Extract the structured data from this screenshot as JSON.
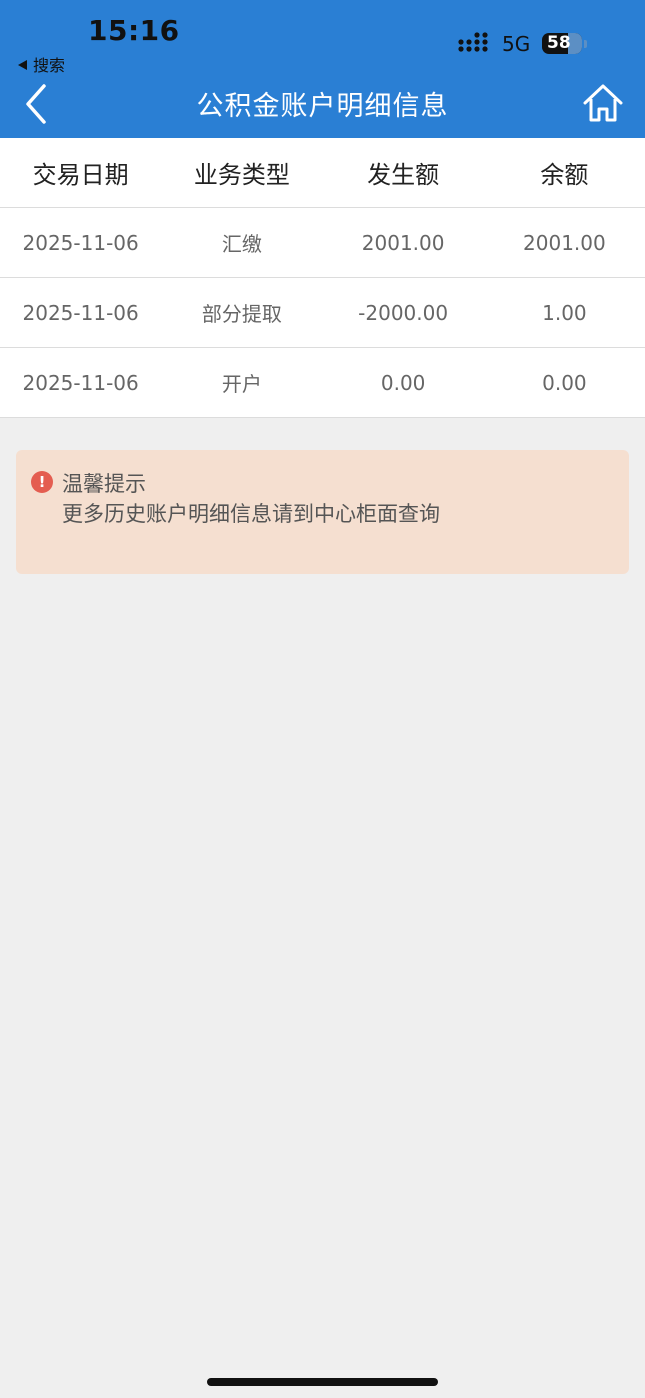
{
  "status_bar": {
    "time": "15:16",
    "back_label": "搜索",
    "network": "5G",
    "battery": "58"
  },
  "nav": {
    "title": "公积金账户明细信息",
    "back_icon": "chevron-left-icon",
    "home_icon": "home-icon"
  },
  "table": {
    "headers": [
      "交易日期",
      "业务类型",
      "发生额",
      "余额"
    ],
    "rows": [
      [
        "2025-11-06",
        "汇缴",
        "2001.00",
        "2001.00"
      ],
      [
        "2025-11-06",
        "部分提取",
        "-2000.00",
        "1.00"
      ],
      [
        "2025-11-06",
        "开户",
        "0.00",
        "0.00"
      ]
    ]
  },
  "notice": {
    "icon": "exclamation-circle-icon",
    "title": "温馨提示",
    "text": "更多历史账户明细信息请到中心柜面查询"
  },
  "colors": {
    "header_bg": "#2a7fd4",
    "notice_bg": "#f5dfd0",
    "notice_icon": "#e45d50",
    "page_bg": "#efefef"
  }
}
